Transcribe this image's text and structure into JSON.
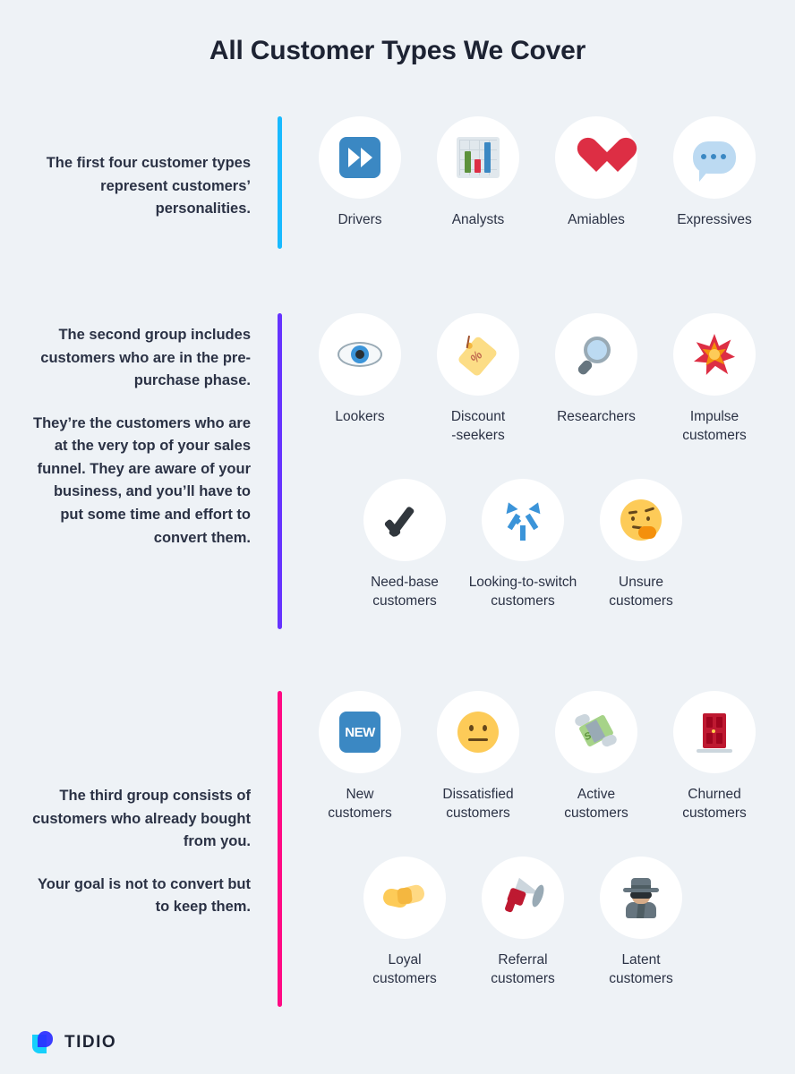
{
  "page": {
    "title": "All Customer Types We Cover",
    "background_color": "#eef2f6",
    "text_color": "#2b3245"
  },
  "sections": [
    {
      "id": "section-1",
      "accent_color": "#18baff",
      "paragraphs": [
        "The first four customer types represent customers’ personalities."
      ],
      "rows": [
        {
          "id": "row-1",
          "items": [
            {
              "label": "Drivers",
              "icon": "fast-forward-icon"
            },
            {
              "label": "Analysts",
              "icon": "bar-chart-icon"
            },
            {
              "label": "Amiables",
              "icon": "heart-icon"
            },
            {
              "label": "Expressives",
              "icon": "speech-balloon-icon"
            }
          ]
        }
      ]
    },
    {
      "id": "section-2",
      "accent_color": "#6633ff",
      "paragraphs": [
        "The second group includes customers who are in the pre-purchase phase.",
        "They’re the customers who are at the very top of your sales funnel. They are aware of your business, and you’ll have to put some time and effort to convert them."
      ],
      "rows": [
        {
          "id": "row-2",
          "items": [
            {
              "label": "Lookers",
              "icon": "eye-icon"
            },
            {
              "label": "Discount\n-seekers",
              "icon": "discount-tag-icon"
            },
            {
              "label": "Researchers",
              "icon": "magnifying-glass-icon"
            },
            {
              "label": "Impulse\ncustomers",
              "icon": "collision-star-icon"
            }
          ]
        },
        {
          "id": "row-3",
          "items": [
            {
              "label": "Need-base\ncustomers",
              "icon": "check-mark-icon"
            },
            {
              "label": "Looking-to-switch\ncustomers",
              "icon": "fork-arrows-icon"
            },
            {
              "label": "Unsure\ncustomers",
              "icon": "thinking-face-icon"
            }
          ]
        }
      ]
    },
    {
      "id": "section-3",
      "accent_color": "#ff0a84",
      "paragraphs": [
        "The third group consists of customers who already bought from you.",
        "Your goal is not to convert but to keep them."
      ],
      "rows": [
        {
          "id": "row-4",
          "items": [
            {
              "label": "New\ncustomers",
              "icon": "new-button-icon"
            },
            {
              "label": "Dissatisfied\ncustomers",
              "icon": "neutral-face-icon"
            },
            {
              "label": "Active\ncustomers",
              "icon": "money-with-wings-icon"
            },
            {
              "label": "Churned\ncustomers",
              "icon": "closed-door-icon"
            }
          ]
        },
        {
          "id": "row-5",
          "items": [
            {
              "label": "Loyal\ncustomers",
              "icon": "handshake-icon"
            },
            {
              "label": "Referral\ncustomers",
              "icon": "megaphone-icon"
            },
            {
              "label": "Latent\ncustomers",
              "icon": "detective-icon"
            }
          ]
        }
      ]
    }
  ],
  "footer": {
    "brand": "TIDIO",
    "logo_colors": {
      "cyan": "#16d0fb",
      "blue": "#2a2eff"
    }
  }
}
